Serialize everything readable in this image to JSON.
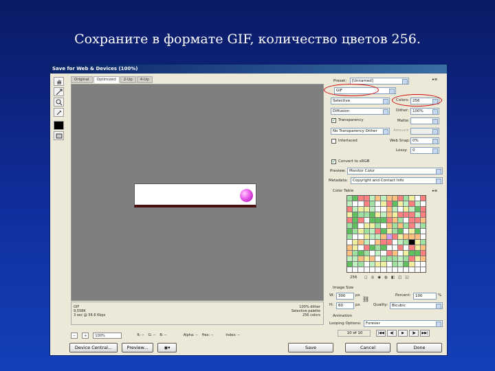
{
  "slide": {
    "title": "Сохраните в формате GIF, количество цветов 256."
  },
  "window": {
    "title": "Save for Web & Devices (100%)"
  },
  "tabs": [
    "Original",
    "Optimized",
    "2-Up",
    "4-Up"
  ],
  "info": {
    "left": [
      "GIF",
      "9,558K",
      "3 sec @ 56.6 Kbps"
    ],
    "right": [
      "100% dither",
      "Selective palette",
      "256 colors"
    ]
  },
  "status": {
    "zoom": "100%",
    "r": "R: --",
    "g": "G: --",
    "b": "B: --",
    "alpha": "Alpha: --",
    "hex": "Hex: --",
    "index": "Index: --"
  },
  "buttons": {
    "device_central": "Device Central...",
    "preview": "Preview...",
    "save": "Save",
    "cancel": "Cancel",
    "done": "Done"
  },
  "settings": {
    "preset_label": "Preset:",
    "preset": "[Unnamed]",
    "format": "GIF",
    "reduction": "Selective",
    "colors_label": "Colors:",
    "colors": "256",
    "dither_algo": "Diffusion",
    "dither_label": "Dither:",
    "dither": "100%",
    "transparency": "Transparency",
    "matte_label": "Matte:",
    "matte": "",
    "trans_dither": "No Transparency Dither",
    "amount_label": "Amount:",
    "amount": "",
    "interlaced": "Interlaced",
    "websnap_label": "Web Snap:",
    "websnap": "0%",
    "lossy_label": "Lossy:",
    "lossy": "0",
    "convert_srgb": "Convert to sRGB",
    "preview_label": "Preview:",
    "preview": "Monitor Color",
    "metadata_label": "Metadata:",
    "metadata": "Copyright and Contact Info"
  },
  "color_table": {
    "title": "Color Table",
    "count": "256"
  },
  "image_size": {
    "title": "Image Size",
    "w_label": "W:",
    "w": "300",
    "h_label": "H:",
    "h": "60",
    "unit": "px",
    "percent_label": "Percent:",
    "percent": "100",
    "percent_unit": "%",
    "quality_label": "Quality:",
    "quality": "Bicubic"
  },
  "animation": {
    "title": "Animation",
    "looping_label": "Looping Options:",
    "looping": "Forever",
    "frame": "10 of 10"
  },
  "colors": {
    "accent_ring": "#d01010",
    "bg": "#0f2e9c",
    "title_bar": "#0a246a"
  }
}
